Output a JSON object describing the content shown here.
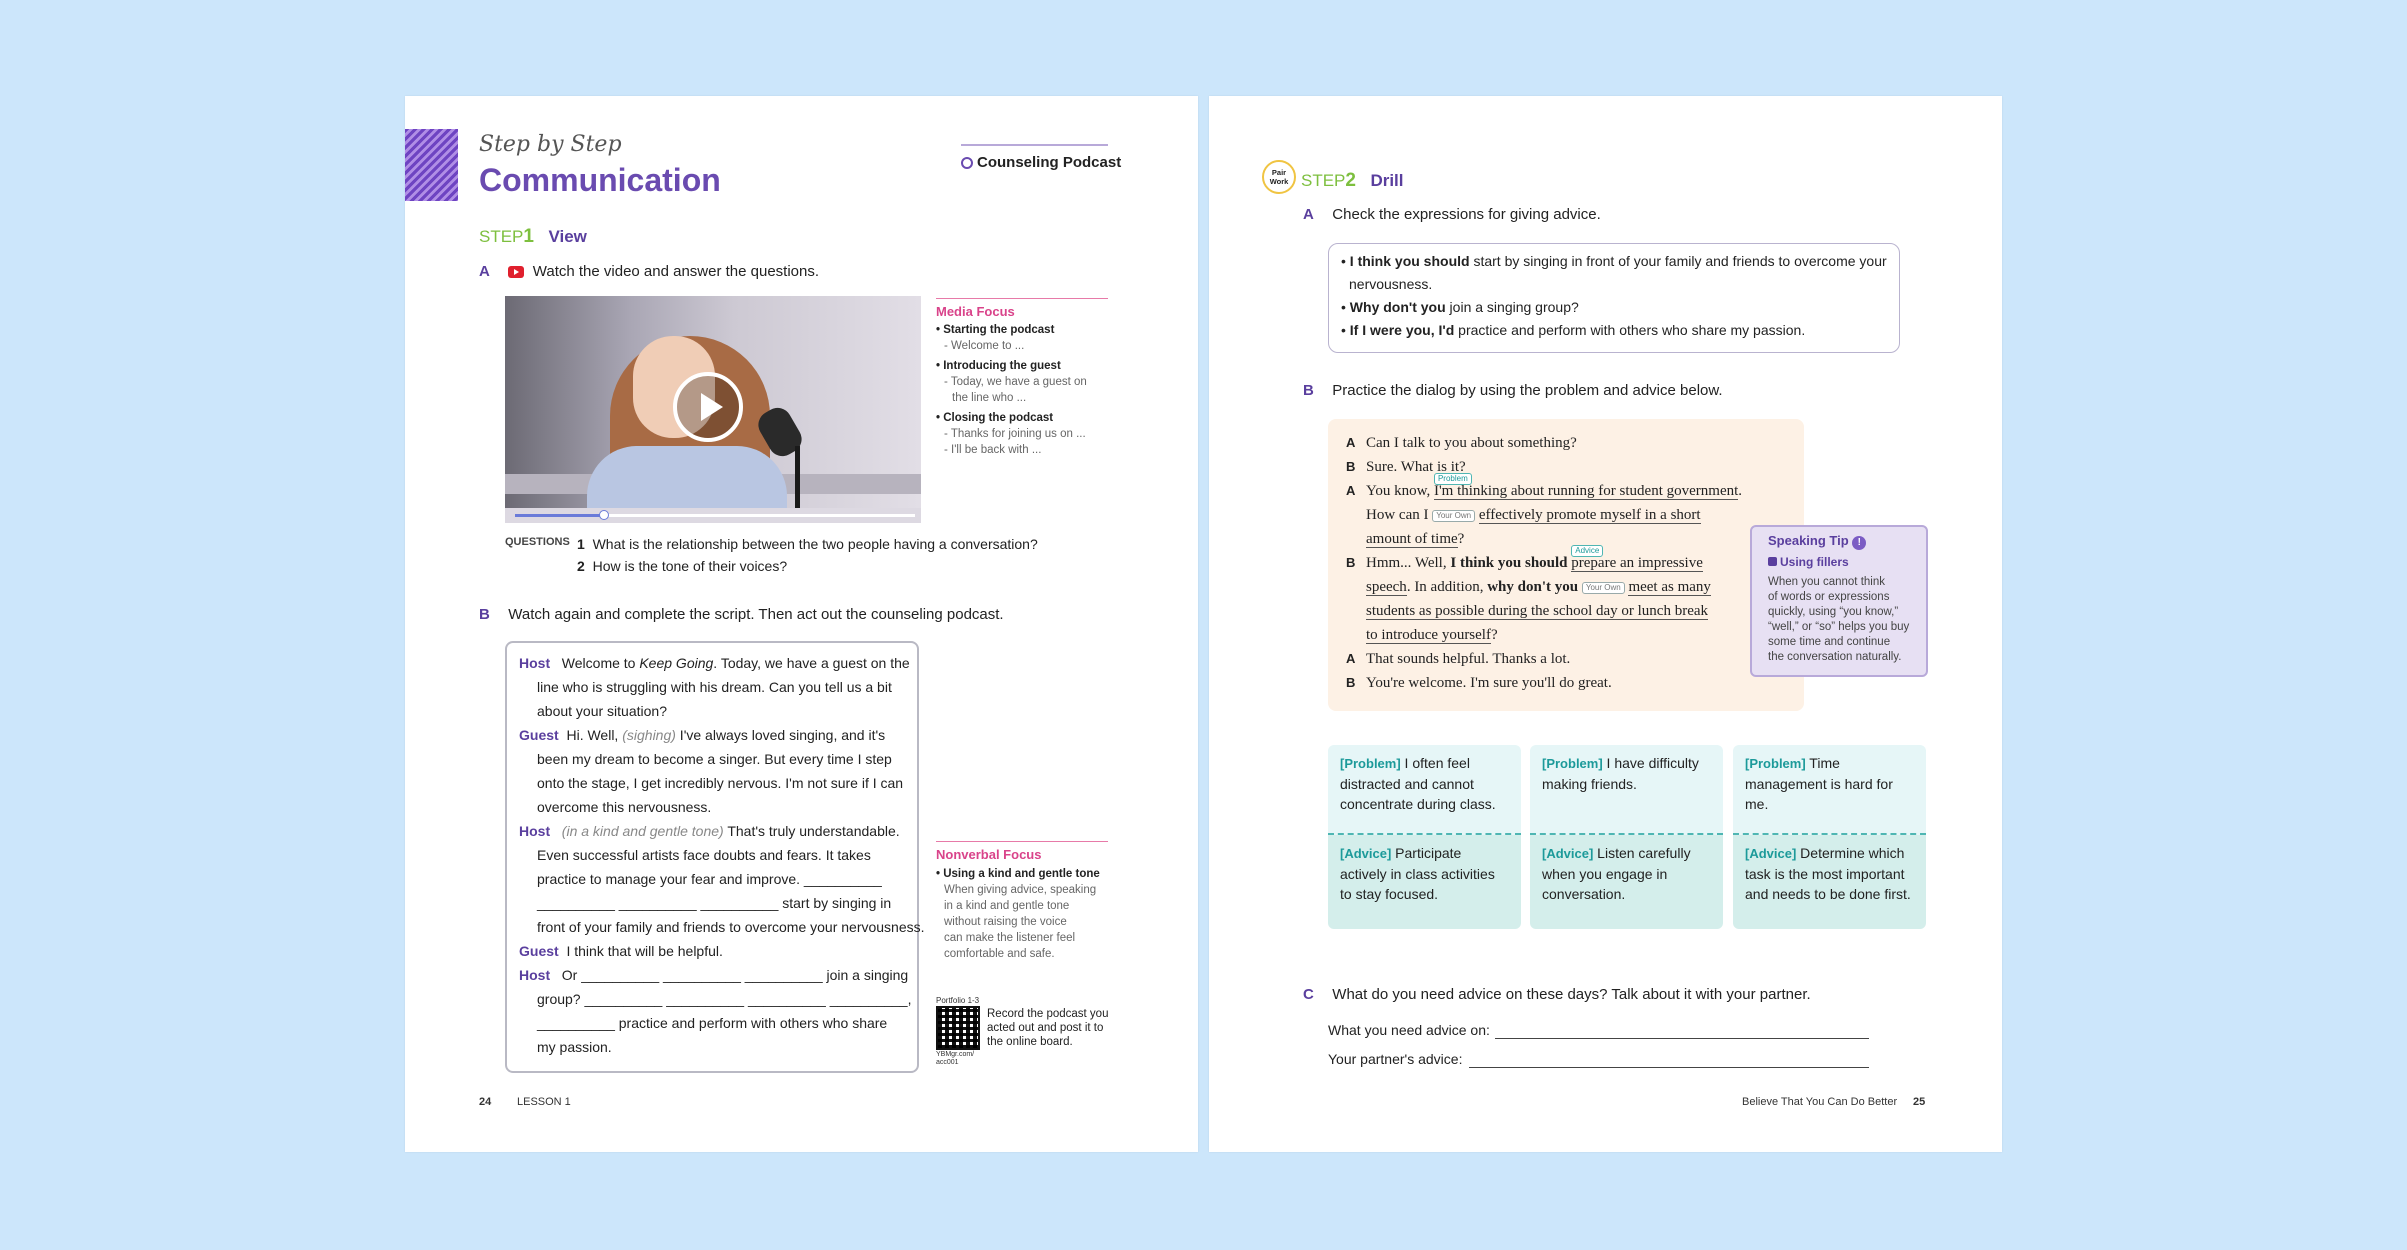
{
  "left_page": {
    "series": "Step by Step",
    "title": "Communication",
    "tag": "Counseling Podcast",
    "step1": {
      "label": "STEP",
      "num": "1",
      "name": "View"
    },
    "secA": {
      "letter": "A",
      "text": "Watch the video and answer the questions."
    },
    "media_focus": {
      "title": "Media Focus",
      "items": [
        {
          "head": "Starting the podcast",
          "subs": [
            "- Welcome to ..."
          ]
        },
        {
          "head": "Introducing the guest",
          "subs": [
            "- Today, we have a guest on",
            "the line who ..."
          ]
        },
        {
          "head": "Closing the podcast",
          "subs": [
            "- Thanks for joining us on ...",
            "- I'll be back with ..."
          ]
        }
      ]
    },
    "questions": {
      "label": "QUESTIONS",
      "items": [
        {
          "n": "1",
          "text": "What is the relationship between the two people having a conversation?"
        },
        {
          "n": "2",
          "text": "How is the tone of their voices?"
        }
      ]
    },
    "secB": {
      "letter": "B",
      "text": "Watch again and complete the script. Then act out the counseling podcast."
    },
    "script": {
      "l1_sp": "Host",
      "l1": "Welcome to ",
      "l1_it": "Keep Going",
      "l1b": ". Today, we have a guest on the",
      "l2": "line who is struggling with his dream. Can you tell us a bit",
      "l3": "about your situation?",
      "l4_sp": "Guest",
      "l4": "Hi. Well, ",
      "l4_it": "(sighing)",
      "l4b": " I've always loved singing, and it's",
      "l5": "been my dream to become a singer. But every time I step",
      "l6": "onto the stage, I get incredibly nervous. I'm not sure if I can",
      "l7": "overcome this nervousness.",
      "l8_sp": "Host",
      "l8_it": "(in a kind and gentle tone)",
      "l8b": " That's truly understandable.",
      "l9": "Even successful artists face doubts and fears. It takes",
      "l10": "practice to manage your fear and improve. __________",
      "l11": "__________ __________ __________ start by singing in",
      "l12": "front of your family and friends to overcome your nervousness.",
      "l13_sp": "Guest",
      "l13": "I think that will be helpful.",
      "l14_sp": "Host",
      "l14": "Or __________ __________ __________ join a singing",
      "l15": "group? __________ __________ __________ __________,",
      "l16": "__________ practice and perform with others who share",
      "l17": "my passion."
    },
    "nonverbal": {
      "title": "Nonverbal Focus",
      "head": "Using a kind and gentle tone",
      "lines": [
        "When giving advice, speaking",
        "in a kind and gentle tone",
        "without raising the voice",
        "can make the listener feel",
        "comfortable and safe."
      ]
    },
    "portfolio": {
      "label": "Portfolio 1-3",
      "code": "YBMgr.com/ acc001",
      "text": [
        "Record the podcast you",
        "acted out and post it to",
        "the online board."
      ]
    },
    "footer": {
      "page": "24",
      "lesson": "LESSON 1"
    }
  },
  "right_page": {
    "pair": "Pair Work",
    "step2": {
      "label": "STEP",
      "num": "2",
      "name": "Drill"
    },
    "secA": {
      "letter": "A",
      "text": "Check the expressions for giving advice."
    },
    "expressions": [
      {
        "bold": "I think you should",
        "rest": " start by singing in front of your family and friends to overcome your",
        "rest2": "nervousness."
      },
      {
        "bold": "Why don't you",
        "rest": " join a singing group?",
        "rest2": ""
      },
      {
        "bold": "If I were you, I'd",
        "rest": " practice and perform with others who share my passion.",
        "rest2": ""
      }
    ],
    "secB": {
      "letter": "B",
      "text": "Practice the dialog by using the problem and advice below."
    },
    "dialog": {
      "a1": "Can I talk to you about something?",
      "b1": "Sure. What is it?",
      "a2_pre": "You know, ",
      "a2_ul": "I'm thinking about running for student government",
      "a2_post": ".",
      "a3_pre": "How can I ",
      "a3_ul": "effectively promote myself in a short",
      "a4_ul": "amount of time",
      "a4_post": "?",
      "b2_pre": "Hmm... Well, ",
      "b2_bold": "I think you should",
      "b2_ul": "prepare an impressive",
      "b3_ul": "speech",
      "b3_mid": ". In addition, ",
      "b3_bold": "why don't you",
      "b3_ul2": "meet as many",
      "b4_ul": "students as possible during the school day or lunch break",
      "b5_ul": "to introduce yourself",
      "b5_post": "?",
      "a5": "That sounds helpful. Thanks a lot.",
      "b6": "You're welcome. I'm sure you'll do great.",
      "tag_problem": "Problem",
      "tag_own": "Your Own",
      "tag_advice": "Advice",
      "spk_a": "A",
      "spk_b": "B"
    },
    "tip": {
      "title": "Speaking Tip",
      "sub": "Using fillers",
      "lines": [
        "When you cannot think",
        "of words or expressions",
        "quickly, using “you know,”",
        "“well,” or “so” helps you buy",
        "some time and continue",
        "the conversation naturally."
      ]
    },
    "cards": [
      {
        "p_label": "[Problem]",
        "problem": " I often feel distracted and cannot concentrate during class.",
        "a_label": "[Advice]",
        "advice": " Participate actively in class activities to stay focused."
      },
      {
        "p_label": "[Problem]",
        "problem": " I have difficulty making friends.",
        "a_label": "[Advice]",
        "advice": " Listen carefully when you engage in conversation."
      },
      {
        "p_label": "[Problem]",
        "problem": " Time management is hard for me.",
        "a_label": "[Advice]",
        "advice": " Determine which task is the most important and needs to be done first."
      }
    ],
    "secC": {
      "letter": "C",
      "text": "What do you need advice on these days? Talk about it with your partner."
    },
    "write1": "What you need advice on:",
    "write2": "Your partner's advice:",
    "footer": {
      "title": "Believe That You Can Do Better",
      "page": "25"
    }
  },
  "colors": {
    "background": "#cce6fb",
    "purple": "#5a3f9e",
    "green": "#7dbf3e",
    "pink": "#d9438a",
    "teal": "#1c9a9a"
  }
}
